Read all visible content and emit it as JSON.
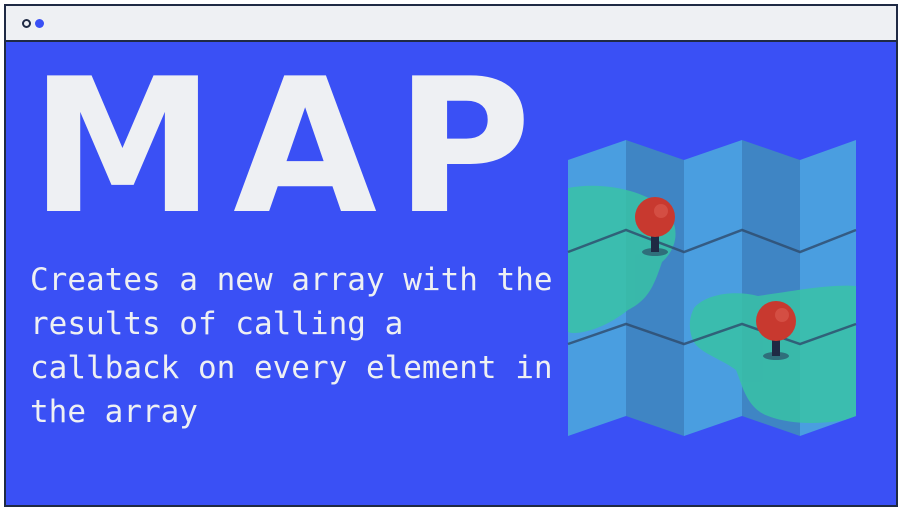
{
  "window": {
    "titlebar_dots": [
      "window-control-dot",
      "window-control-dot"
    ]
  },
  "hero": {
    "title": "MAP",
    "description": "Creates a new array with the results of calling a callback on every element in the array"
  },
  "illustration": {
    "icon": "folded-map-with-pins-icon",
    "pin_count": 2
  },
  "colors": {
    "background": "#3a50f5",
    "titlebar": "#eef0f3",
    "text": "#eef0f3",
    "border": "#1f2a44",
    "map_panel_light": "#4a9ee0",
    "map_panel_dark": "#3f85c4",
    "land": "#38c2a6",
    "pin": "#c8392f"
  }
}
